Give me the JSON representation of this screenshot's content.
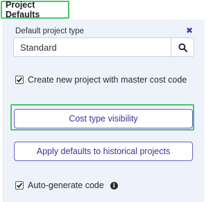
{
  "tab": {
    "label": "Project Defaults"
  },
  "default_project_type": {
    "label": "Default project type",
    "value": "Standard",
    "clear_icon": "close-icon",
    "search_icon": "search-icon"
  },
  "master_cost_code": {
    "label": "Create new project with master cost code",
    "checked": true
  },
  "buttons": {
    "cost_type_visibility": "Cost type visibility",
    "apply_defaults": "Apply defaults to historical projects"
  },
  "auto_generate": {
    "label": "Auto-generate code",
    "checked": true,
    "info_icon": "info-icon"
  },
  "colors": {
    "accent": "#3d2f9c",
    "highlight": "#49c46b",
    "panel_bg": "#eef3fb"
  }
}
